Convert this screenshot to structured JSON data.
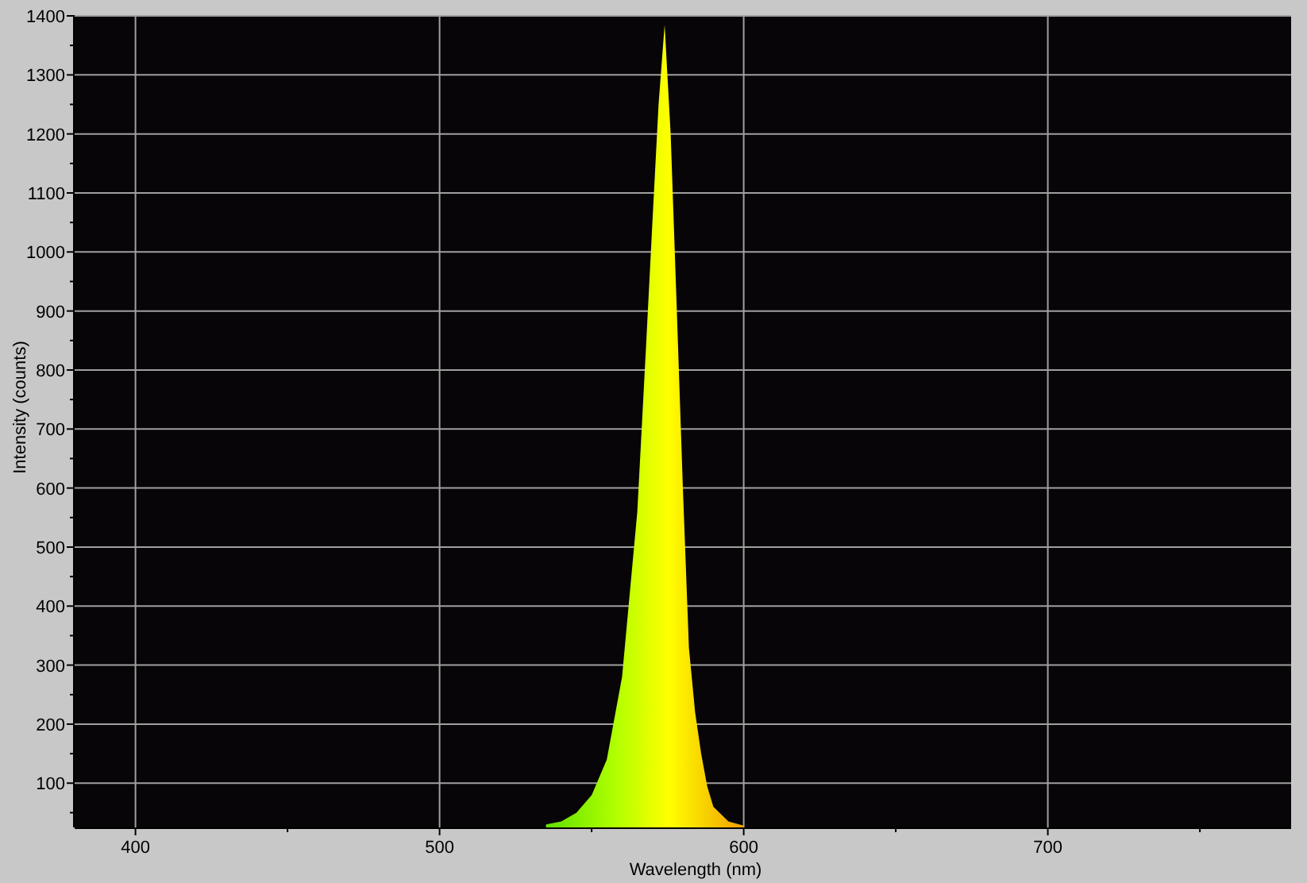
{
  "chart_data": {
    "type": "area",
    "grid": true,
    "xlabel": "Wavelength (nm)",
    "ylabel": "Intensity (counts)",
    "xlim": [
      380,
      780
    ],
    "ylim": [
      25,
      1400
    ],
    "xticks": [
      400,
      500,
      600,
      700
    ],
    "yticks": [
      100,
      200,
      300,
      400,
      500,
      600,
      700,
      800,
      900,
      1000,
      1100,
      1200,
      1300,
      1400
    ],
    "x": [
      535,
      540,
      545,
      550,
      555,
      560,
      565,
      568,
      570,
      572,
      574,
      576,
      578,
      580,
      582,
      584,
      586,
      588,
      590,
      595,
      600
    ],
    "series": [
      {
        "color": "#ffff00",
        "values": [
          30,
          35,
          50,
          80,
          140,
          280,
          560,
          850,
          1050,
          1250,
          1385,
          1200,
          900,
          600,
          330,
          220,
          150,
          95,
          60,
          35,
          28
        ]
      }
    ]
  }
}
